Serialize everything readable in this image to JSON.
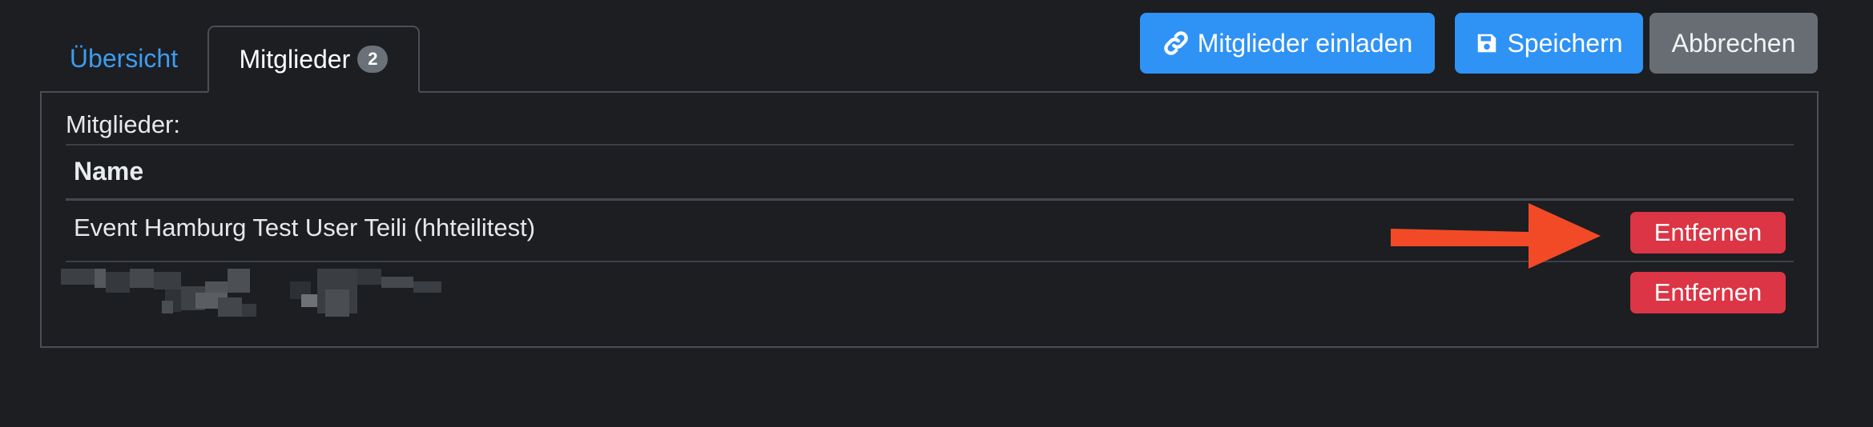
{
  "tabs": {
    "overview_label": "Übersicht",
    "members_label": "Mitglieder",
    "members_count": "2"
  },
  "toolbar": {
    "invite_label": "Mitglieder einladen",
    "save_label": "Speichern",
    "cancel_label": "Abbrechen"
  },
  "members": {
    "section_label": "Mitglieder:",
    "column_name": "Name",
    "rows": [
      {
        "name": "Event Hamburg Test User Teili (hhteilitest)",
        "remove_label": "Entfernen"
      },
      {
        "name": "",
        "remove_label": "Entfernen"
      }
    ]
  },
  "colors": {
    "background": "#1c1e22",
    "primary": "#2f92f5",
    "secondary": "#686d73",
    "danger": "#dc3545",
    "annotation_arrow": "#f24a27"
  },
  "icons": {
    "invite": "link-icon",
    "save": "floppy-disk-icon"
  }
}
